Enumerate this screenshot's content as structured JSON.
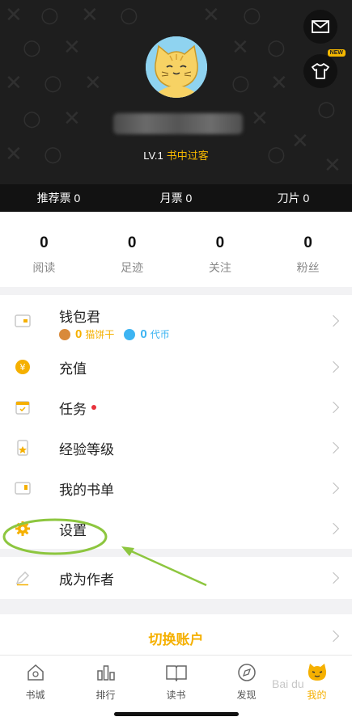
{
  "header": {
    "new_badge": "NEW",
    "level": "LV.1",
    "level_title": "书中过客",
    "stats": [
      {
        "label": "推荐票 0"
      },
      {
        "label": "月票 0"
      },
      {
        "label": "刀片 0"
      }
    ]
  },
  "counts": [
    {
      "value": "0",
      "label": "阅读"
    },
    {
      "value": "0",
      "label": "足迹"
    },
    {
      "value": "0",
      "label": "关注"
    },
    {
      "value": "0",
      "label": "粉丝"
    }
  ],
  "menu": {
    "wallet": {
      "label": "钱包君",
      "cat_cookie_value": "0",
      "cat_cookie_label": "猫饼干",
      "coin_value": "0",
      "coin_label": "代币"
    },
    "recharge": "充值",
    "tasks": "任务",
    "exp_level": "经验等级",
    "my_booklist": "我的书单",
    "settings": "设置",
    "become_author": "成为作者"
  },
  "switch_account": "切换账户",
  "tabs": [
    {
      "label": "书城",
      "icon": "house-icon"
    },
    {
      "label": "排行",
      "icon": "bar-chart-icon"
    },
    {
      "label": "读书",
      "icon": "open-book-icon"
    },
    {
      "label": "发现",
      "icon": "compass-icon"
    },
    {
      "label": "我的",
      "icon": "cat-face-icon",
      "active": true
    }
  ],
  "watermark": "Bai du",
  "colors": {
    "accent": "#f5b000",
    "header_bg": "#1e1e1e",
    "annotation": "#8dc63f"
  }
}
